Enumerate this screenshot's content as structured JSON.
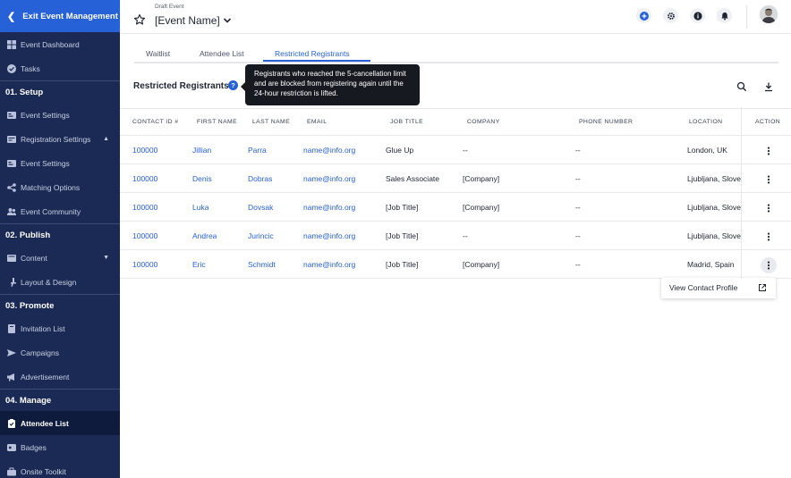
{
  "sidebar": {
    "exit_label": "Exit Event Management",
    "items_top": [
      {
        "label": "Event Dashboard",
        "icon": "dashboard-icon"
      },
      {
        "label": "Tasks",
        "icon": "check-circle-icon"
      }
    ],
    "sections": [
      {
        "label": "01. Setup",
        "items": [
          {
            "label": "Event Settings",
            "icon": "settings-icon"
          },
          {
            "label": "Registration Settings",
            "icon": "registration-icon",
            "caret": "▲"
          },
          {
            "label": "Event Settings",
            "icon": "settings-icon"
          },
          {
            "label": "Matching Options",
            "icon": "share-icon"
          },
          {
            "label": "Event Community",
            "icon": "people-icon"
          }
        ]
      },
      {
        "label": "02. Publish",
        "items": [
          {
            "label": "Content",
            "icon": "content-icon",
            "caret": "▼"
          },
          {
            "label": "Layout & Design",
            "icon": "brush-icon"
          }
        ]
      },
      {
        "label": "03. Promote",
        "items": [
          {
            "label": "Invitation List",
            "icon": "invitation-icon"
          },
          {
            "label": "Campaigns",
            "icon": "send-icon"
          },
          {
            "label": "Advertisement",
            "icon": "megaphone-icon"
          }
        ]
      },
      {
        "label": "04. Manage",
        "items": [
          {
            "label": "Attendee List",
            "icon": "clipboard-icon",
            "active": true
          },
          {
            "label": "Badges",
            "icon": "badge-icon"
          },
          {
            "label": "Onsite Toolkit",
            "icon": "toolkit-icon"
          }
        ]
      }
    ]
  },
  "header": {
    "draft_label": "Draft Event",
    "event_name": "[Event Name]"
  },
  "tabs": [
    {
      "label": "Waitlist"
    },
    {
      "label": "Attendee List"
    },
    {
      "label": "Restricted Registrants",
      "active": true
    }
  ],
  "section": {
    "title": "Restricted Registrants",
    "help": "?",
    "tooltip": "Registrants who reached the 5-cancellation limit and are blocked from registering again until the 24-hour restriction is lifted."
  },
  "table": {
    "columns": [
      "CONTACT ID #",
      "FIRST NAME",
      "LAST NAME",
      "EMAIL",
      "JOB TITLE",
      "COMPANY",
      "PHONE NUMBER",
      "LOCATION",
      "ACTION"
    ],
    "rows": [
      [
        "100000",
        "Jillian",
        "Parra",
        "name@info.org",
        "Glue Up",
        "--",
        "--",
        "London, UK"
      ],
      [
        "100000",
        "Denis",
        "Dobras",
        "name@info.org",
        "Sales Associate",
        "[Company]",
        "--",
        "Ljubljana, Slovenia"
      ],
      [
        "100000",
        "Luka",
        "Dovsak",
        "name@info.org",
        "[Job Title]",
        "[Company]",
        "--",
        "Ljubljana, Slovenia"
      ],
      [
        "100000",
        "Andrea",
        "Jurincic",
        "name@info.org",
        "[Job Title]",
        "--",
        "--",
        "Ljubljana, Slovenia"
      ],
      [
        "100000",
        "Eric",
        "Schmidt",
        "name@info.org",
        "[Job Title]",
        "[Company]",
        "--",
        "Madrid, Spain"
      ]
    ]
  },
  "action_menu": {
    "label": "View Contact Profile"
  },
  "colors": {
    "sidebar_bg": "#1b2a55",
    "accent": "#2761d8",
    "active_nav": "#0f1b3d",
    "tooltip_bg": "#16191f"
  }
}
